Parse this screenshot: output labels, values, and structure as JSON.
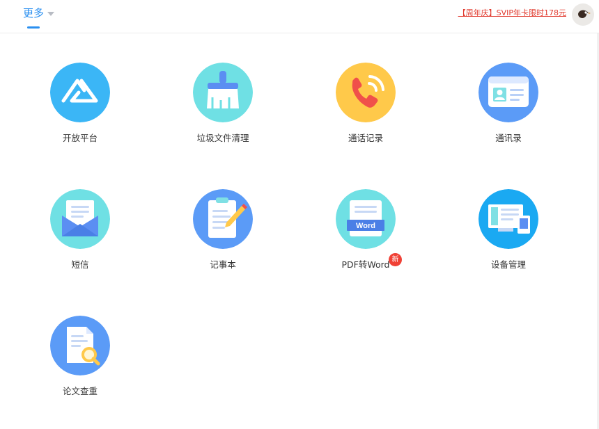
{
  "header": {
    "tab_label": "更多",
    "promo_text": "【周年庆】SVIP年卡限时178元"
  },
  "tools": [
    {
      "label": "开放平台",
      "icon": "open-platform-icon",
      "color": "#3bb6f6"
    },
    {
      "label": "垃圾文件清理",
      "icon": "broom-icon",
      "color": "#6fe0e4"
    },
    {
      "label": "通话记录",
      "icon": "phone-icon",
      "color": "#ffc94a"
    },
    {
      "label": "通讯录",
      "icon": "contact-card-icon",
      "color": "#5b9bf7"
    },
    {
      "label": "短信",
      "icon": "envelope-icon",
      "color": "#6fe0e4"
    },
    {
      "label": "记事本",
      "icon": "notepad-icon",
      "color": "#5b9bf7"
    },
    {
      "label": "PDF转Word",
      "icon": "pdf-word-icon",
      "color": "#6fe0e4",
      "icon_text": "Word",
      "badge": "新"
    },
    {
      "label": "设备管理",
      "icon": "devices-icon",
      "color": "#1aa9f2"
    },
    {
      "label": "论文查重",
      "icon": "paper-search-icon",
      "color": "#5b9bf7"
    }
  ]
}
